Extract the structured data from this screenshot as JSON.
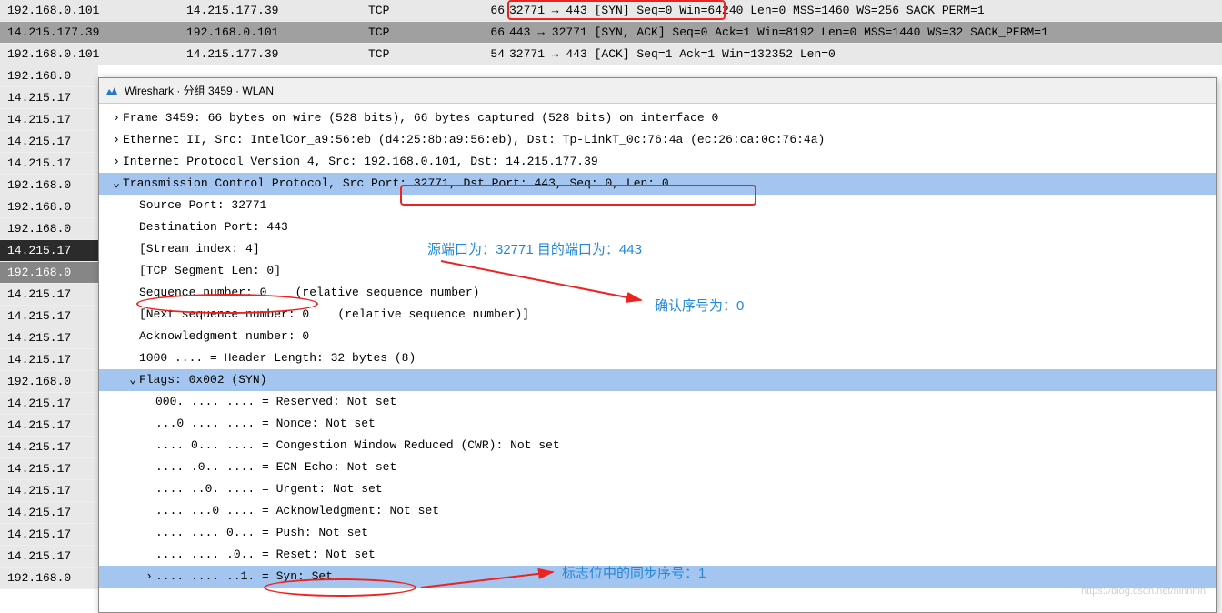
{
  "packets_full": [
    {
      "src": "192.168.0.101",
      "dst": "14.215.177.39",
      "proto": "TCP",
      "len": "66",
      "info": "32771 → 443 [SYN] Seq=0 Win=64240 Len=0 MSS=1460 WS=256 SACK_PERM=1",
      "cls": "normal"
    },
    {
      "src": "14.215.177.39",
      "dst": "192.168.0.101",
      "proto": "TCP",
      "len": "66",
      "info": "443 → 32771 [SYN, ACK] Seq=0 Ack=1 Win=8192 Len=0 MSS=1440 WS=32 SACK_PERM=1",
      "cls": "selected"
    },
    {
      "src": "192.168.0.101",
      "dst": "14.215.177.39",
      "proto": "TCP",
      "len": "54",
      "info": "32771 → 443 [ACK] Seq=1 Ack=1 Win=132352 Len=0",
      "cls": "normal"
    }
  ],
  "packets_partial": [
    {
      "ip": "192.168.0",
      "cls": "normal"
    },
    {
      "ip": "14.215.17",
      "cls": "normal"
    },
    {
      "ip": "14.215.17",
      "cls": "normal"
    },
    {
      "ip": "14.215.17",
      "cls": "normal"
    },
    {
      "ip": "14.215.17",
      "cls": "normal"
    },
    {
      "ip": "192.168.0",
      "cls": "normal"
    },
    {
      "ip": "192.168.0",
      "cls": "normal"
    },
    {
      "ip": "192.168.0",
      "cls": "normal"
    },
    {
      "ip": "14.215.17",
      "cls": "dark"
    },
    {
      "ip": "192.168.0",
      "cls": "gray"
    },
    {
      "ip": "14.215.17",
      "cls": "normal"
    },
    {
      "ip": "14.215.17",
      "cls": "normal"
    },
    {
      "ip": "14.215.17",
      "cls": "normal"
    },
    {
      "ip": "14.215.17",
      "cls": "normal"
    },
    {
      "ip": "192.168.0",
      "cls": "normal"
    },
    {
      "ip": "14.215.17",
      "cls": "normal"
    },
    {
      "ip": "14.215.17",
      "cls": "normal"
    },
    {
      "ip": "14.215.17",
      "cls": "normal"
    },
    {
      "ip": "14.215.17",
      "cls": "normal"
    },
    {
      "ip": "14.215.17",
      "cls": "normal"
    },
    {
      "ip": "14.215.17",
      "cls": "normal"
    },
    {
      "ip": "14.215.17",
      "cls": "normal"
    },
    {
      "ip": "14.215.17",
      "cls": "normal"
    },
    {
      "ip": "192.168.0",
      "cls": "normal"
    }
  ],
  "window_title": "Wireshark · 分组 3459 · WLAN",
  "details": {
    "frame": "Frame 3459: 66 bytes on wire (528 bits), 66 bytes captured (528 bits) on interface 0",
    "ethernet": "Ethernet II, Src: IntelCor_a9:56:eb (d4:25:8b:a9:56:eb), Dst: Tp-LinkT_0c:76:4a (ec:26:ca:0c:76:4a)",
    "ip": "Internet Protocol Version 4, Src: 192.168.0.101, Dst: 14.215.177.39",
    "tcp_header": "Transmission Control Protocol, Src Port: 32771, Dst Port: 443, Seq: 0, Len: 0",
    "src_port": "Source Port: 32771",
    "dst_port": "Destination Port: 443",
    "stream_index": "[Stream index: 4]",
    "tcp_seg_len": "[TCP Segment Len: 0]",
    "seq_num": "Sequence number: 0    (relative sequence number)",
    "next_seq": "[Next sequence number: 0    (relative sequence number)]",
    "ack_num": "Acknowledgment number: 0",
    "header_len": "1000 .... = Header Length: 32 bytes (8)",
    "flags_header": "Flags: 0x002 (SYN)",
    "reserved": "000. .... .... = Reserved: Not set",
    "nonce": "...0 .... .... = Nonce: Not set",
    "cwr": ".... 0... .... = Congestion Window Reduced (CWR): Not set",
    "ecn": ".... .0.. .... = ECN-Echo: Not set",
    "urgent": ".... ..0. .... = Urgent: Not set",
    "ack_flag": ".... ...0 .... = Acknowledgment: Not set",
    "push": ".... .... 0... = Push: Not set",
    "reset": ".... .... .0.. = Reset: Not set",
    "syn": ".... .... ..1. = Syn: Set"
  },
  "annotations": {
    "ports": "源端口为：32771 目的端口为：443",
    "seq": "确认序号为：0",
    "syn_flag": "标志位中的同步序号：1"
  },
  "watermark": "https://blog.csdn.net/ninnnin"
}
